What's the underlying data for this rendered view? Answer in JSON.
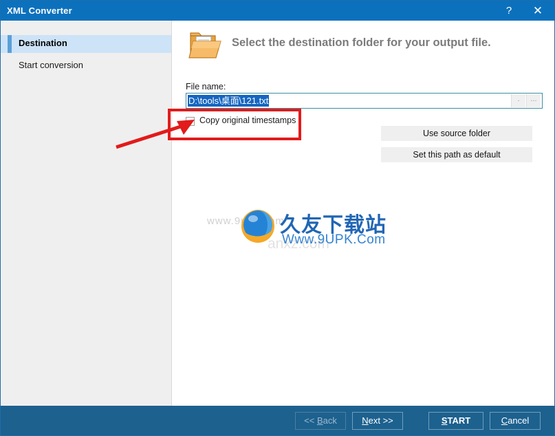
{
  "window": {
    "title": "XML Converter",
    "help_icon": "?",
    "close_icon": "✕",
    "titlebar_color": "#0c71bd",
    "bottombar_color": "#1d618f"
  },
  "sidebar": {
    "items": [
      {
        "label": "Destination",
        "selected": true
      },
      {
        "label": "Start conversion",
        "selected": false
      }
    ]
  },
  "main": {
    "header_title": "Select the destination folder for your output file.",
    "folder_icon": "open-folder-icon",
    "file_name_label": "File name:",
    "file_name_value": "D:\\tools\\桌面\\121.txt",
    "path_button_dot": ".",
    "path_button_dots": "...",
    "checkbox_label": "Copy original timestamps",
    "checkbox_checked": false,
    "buttons": [
      {
        "label": "Use source folder"
      },
      {
        "label": "Set this path as default"
      }
    ]
  },
  "watermark": {
    "ghost_text": "www.9upk.com",
    "ghost_text2": "anxz.com",
    "cn_text": "久友下载站",
    "url_text": "Www.9UPK.Com",
    "globe_icon": "globe-icon"
  },
  "annotation": {
    "rect_color": "#e21b1b",
    "arrow_color": "#e21b1b",
    "target": "copy-original-timestamps-checkbox"
  },
  "footer": {
    "back_label": "<< Back",
    "back_accel": "B",
    "next_label": "Next >>",
    "next_accel": "N",
    "start_label": "START",
    "start_accel": "S",
    "cancel_label": "Cancel",
    "cancel_accel": "C"
  }
}
